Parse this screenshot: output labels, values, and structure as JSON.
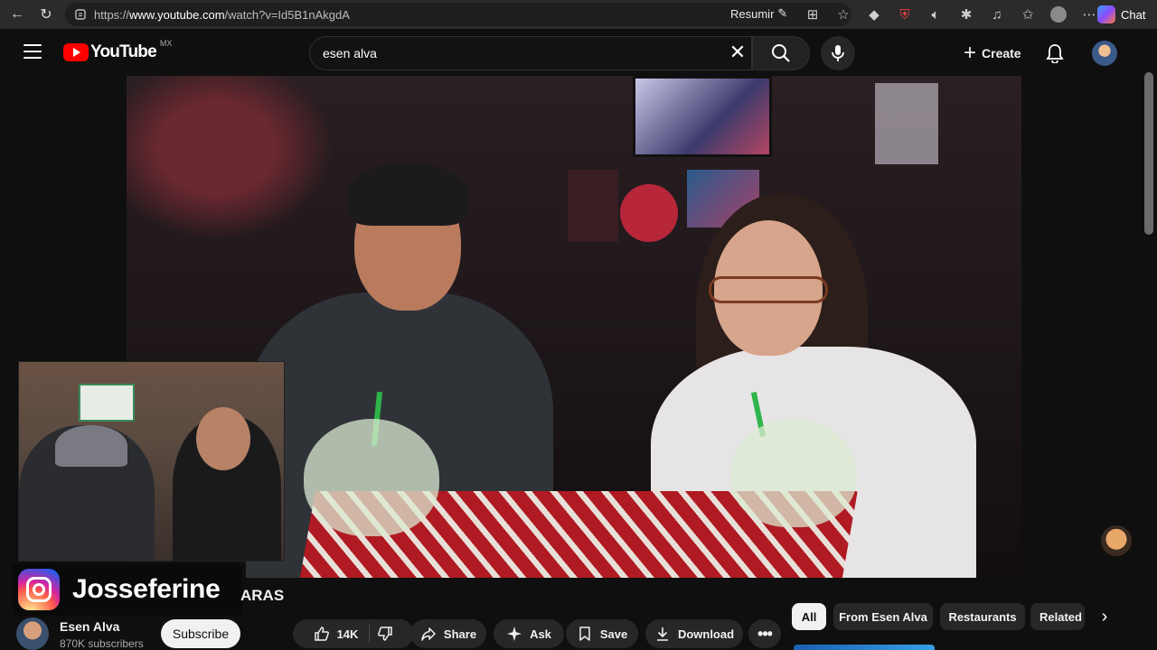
{
  "browser": {
    "url_prefix": "https://",
    "url_host": "www.youtube.com",
    "url_path": "/watch?v=Id5B1nAkgdA",
    "resumir_label": "Resumir",
    "chat_label": "Chat"
  },
  "header": {
    "logo_text": "YouTube",
    "country_code": "MX",
    "search_value": "esen alva",
    "create_label": "Create"
  },
  "video": {
    "overlay_handle": "Josseferine",
    "title_tail": "ARAS"
  },
  "channel": {
    "name": "Esen Alva",
    "subscribers": "870K subscribers",
    "subscribe_label": "Subscribe"
  },
  "actions": {
    "likes": "14K",
    "share": "Share",
    "ask": "Ask",
    "save": "Save",
    "download": "Download"
  },
  "chips": [
    "All",
    "From Esen Alva",
    "Restaurants",
    "Related"
  ],
  "colors": {
    "background": "#0f0f0f",
    "brand_red": "#ff0000",
    "chip_active": "#f1f1f1"
  }
}
